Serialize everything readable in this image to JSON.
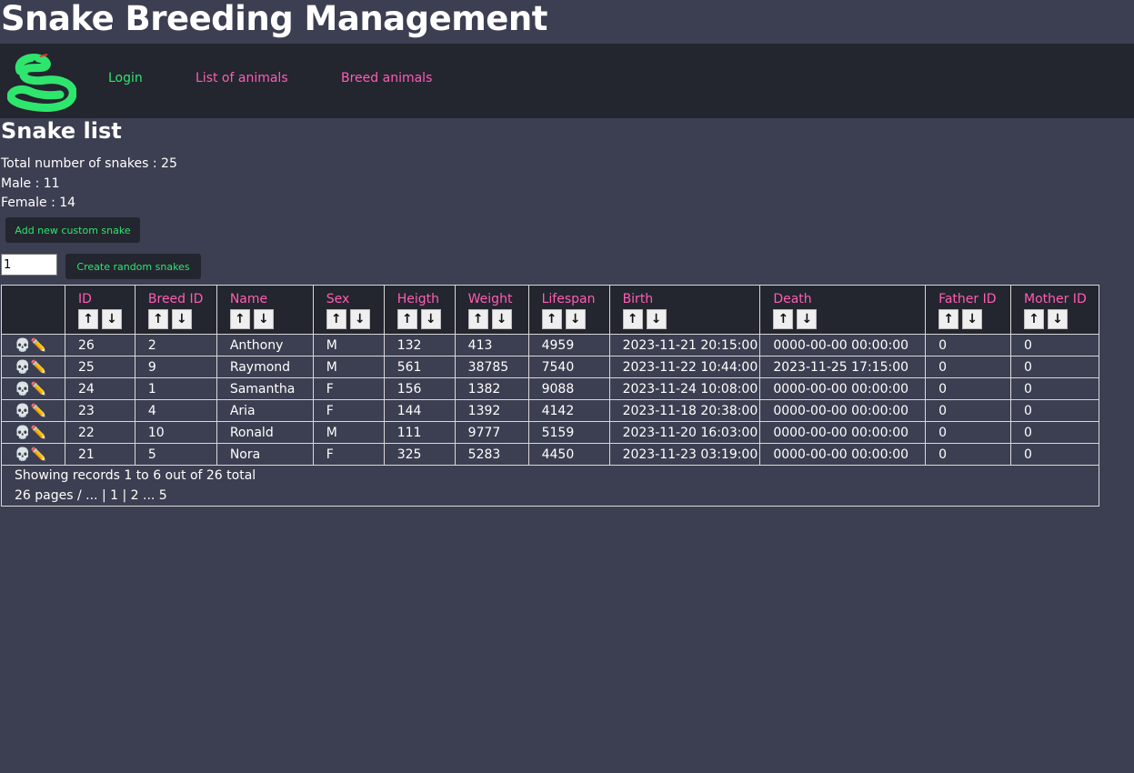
{
  "app": {
    "title": "Snake Breeding Management"
  },
  "nav": {
    "login": "Login",
    "list": "List of animals",
    "breed": "Breed animals"
  },
  "page": {
    "title": "Snake list"
  },
  "stats": {
    "total": "Total number of snakes : 25",
    "male": "Male : 11",
    "female": "Female : 14"
  },
  "actions": {
    "add_label": "Add new custom snake",
    "qty_value": "1",
    "random_label": "Create random snakes"
  },
  "table": {
    "columns": [
      "ID",
      "Breed ID",
      "Name",
      "Sex",
      "Heigth",
      "Weight",
      "Lifespan",
      "Birth",
      "Death",
      "Father ID",
      "Mother ID"
    ],
    "rows": [
      [
        "26",
        "2",
        "Anthony",
        "M",
        "132",
        "413",
        "4959",
        "2023-11-21 20:15:00",
        "0000-00-00 00:00:00",
        "0",
        "0"
      ],
      [
        "25",
        "9",
        "Raymond",
        "M",
        "561",
        "38785",
        "7540",
        "2023-11-22 10:44:00",
        "2023-11-25 17:15:00",
        "0",
        "0"
      ],
      [
        "24",
        "1",
        "Samantha",
        "F",
        "156",
        "1382",
        "9088",
        "2023-11-24 10:08:00",
        "0000-00-00 00:00:00",
        "0",
        "0"
      ],
      [
        "23",
        "4",
        "Aria",
        "F",
        "144",
        "1392",
        "4142",
        "2023-11-18 20:38:00",
        "0000-00-00 00:00:00",
        "0",
        "0"
      ],
      [
        "22",
        "10",
        "Ronald",
        "M",
        "111",
        "9777",
        "5159",
        "2023-11-20 16:03:00",
        "0000-00-00 00:00:00",
        "0",
        "0"
      ],
      [
        "21",
        "5",
        "Nora",
        "F",
        "325",
        "5283",
        "4450",
        "2023-11-23 03:19:00",
        "0000-00-00 00:00:00",
        "0",
        "0"
      ]
    ],
    "sort_up": "↑",
    "sort_down": "↓",
    "kill_icon": "💀",
    "edit_icon": "✏️",
    "footer_records": "Showing records 1 to 6 out of 26 total",
    "footer_pages": "26 pages / ... | 1 | 2 ... 5"
  },
  "colors": {
    "accent_pink": "#ff5db3",
    "accent_green": "#2ee66e",
    "bg": "#3c3f51",
    "panel": "#23252f"
  }
}
